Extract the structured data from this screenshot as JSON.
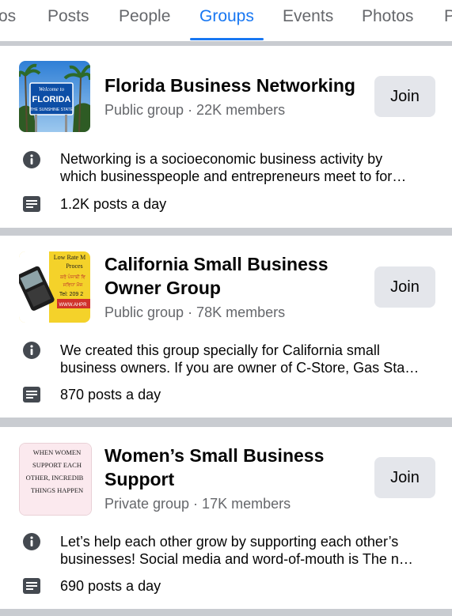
{
  "tabs": [
    {
      "label": "os",
      "active": false
    },
    {
      "label": "Posts",
      "active": false
    },
    {
      "label": "People",
      "active": false
    },
    {
      "label": "Groups",
      "active": true
    },
    {
      "label": "Events",
      "active": false
    },
    {
      "label": "Photos",
      "active": false
    },
    {
      "label": "P",
      "active": false
    }
  ],
  "groups": [
    {
      "name": "Florida Business Networking",
      "meta": "Public group · 22K members",
      "join_label": "Join",
      "description_lines": [
        "Networking is a socioeconomic business activity by",
        "which businesspeople and entrepreneurs meet to for…"
      ],
      "posts_per_day": "1.2K posts a day",
      "thumb": {
        "sign_top": "Welcome to",
        "sign_main": "FLORIDA",
        "sign_sub": "THE SUNSHINE STATE"
      }
    },
    {
      "name": "California Small Business Owner Group",
      "meta": "Public group · 78K members",
      "join_label": "Join",
      "description_lines": [
        "We created this group specially for California small",
        "business owners. If you are owner of C-Store, Gas Sta…"
      ],
      "posts_per_day": "870 posts a day",
      "thumb": {
        "line1": "Low Rate M",
        "line2": "Proces",
        "line3": "ਕਰੋ ਪੰਜਾਬੀ ਵਿ",
        "line4": "ਸਵਿਧਾ ਮੌਜ",
        "line5": "Tel: 209 2",
        "line6": "WWW.AHPR"
      }
    },
    {
      "name": "Women’s Small Business Support",
      "meta": "Private group · 17K members",
      "join_label": "Join",
      "description_lines": [
        "Let’s help each other grow by supporting each other’s",
        "businesses! Social media and word-of-mouth is The n…"
      ],
      "posts_per_day": "690 posts a day",
      "thumb": {
        "line1": "WHEN WOMEN",
        "line2": "SUPPORT EACH",
        "line3": "OTHER, INCREDIB",
        "line4": "THINGS HAPPEN"
      }
    }
  ],
  "colors": {
    "accent": "#1877f2",
    "muted_text": "#65676b",
    "separator": "#c9ccd1",
    "button_bg": "#e4e6eb"
  },
  "icons": {
    "info": "info-circle-icon",
    "posts": "posts-list-icon"
  }
}
